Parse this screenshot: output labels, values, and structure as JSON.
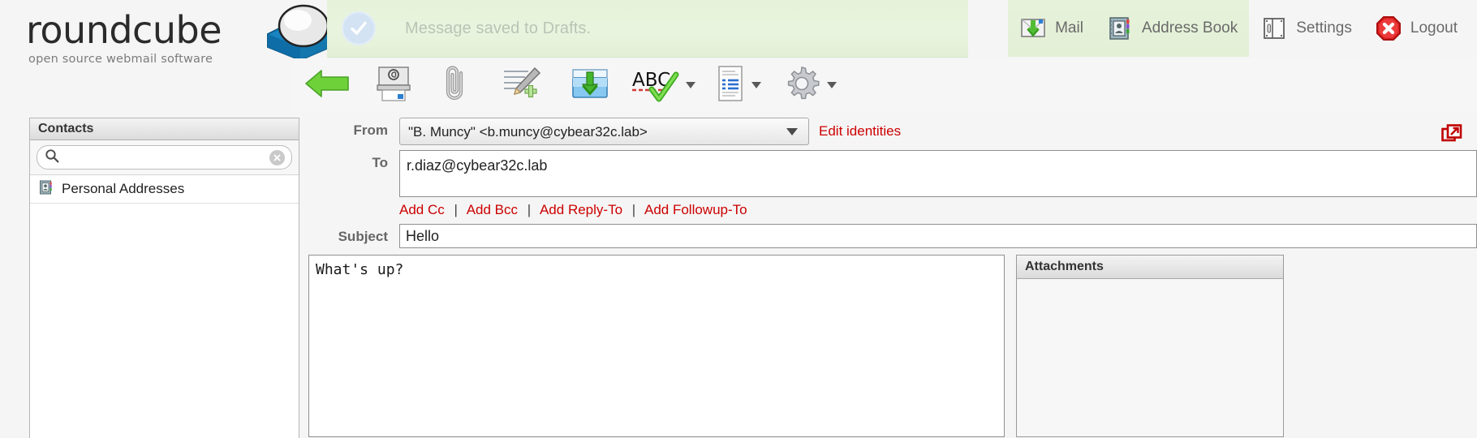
{
  "app": {
    "brand_name": "roundcube",
    "brand_tagline": "open source webmail software",
    "accent_red": "#cc0000",
    "notice_bg": "#e6f2da"
  },
  "notification": {
    "icon": "check-circle-icon",
    "message": "Message saved to Drafts."
  },
  "tasknav": {
    "items": [
      {
        "id": "mail",
        "label": "Mail",
        "icon": "mail-inbox-icon",
        "active": true
      },
      {
        "id": "addressbook",
        "label": "Address Book",
        "icon": "address-book-icon",
        "active": true
      },
      {
        "id": "settings",
        "label": "Settings",
        "icon": "settings-window-icon",
        "active": false
      },
      {
        "id": "logout",
        "label": "Logout",
        "icon": "logout-stop-icon",
        "active": false
      }
    ]
  },
  "toolbar": {
    "buttons": [
      {
        "id": "back",
        "name": "back-button",
        "icon": "green-left-arrow-icon",
        "has_menu": false
      },
      {
        "id": "send",
        "name": "send-button",
        "icon": "send-mail-icon",
        "has_menu": false
      },
      {
        "id": "attach",
        "name": "attach-button",
        "icon": "paperclip-icon",
        "has_menu": false
      },
      {
        "id": "signature",
        "name": "insert-signature-button",
        "icon": "signature-icon",
        "has_menu": false
      },
      {
        "id": "savedraft",
        "name": "save-draft-button",
        "icon": "save-draft-icon",
        "has_menu": false
      },
      {
        "id": "spellcheck",
        "name": "spellcheck-button",
        "icon": "abc-spellcheck-icon",
        "has_menu": true
      },
      {
        "id": "editortype",
        "name": "editor-type-button",
        "icon": "document-editor-icon",
        "has_menu": true
      },
      {
        "id": "options",
        "name": "compose-options-button",
        "icon": "gear-icon",
        "has_menu": true
      }
    ]
  },
  "sidebar": {
    "title": "Contacts",
    "search": {
      "placeholder": "",
      "value": "",
      "icon": "search-icon",
      "clear_icon": "clear-x-icon"
    },
    "sources": [
      {
        "label": "Personal Addresses",
        "icon": "address-book-icon"
      }
    ]
  },
  "compose": {
    "popout_icon": "open-in-new-window-icon",
    "from": {
      "label": "From",
      "selected": "\"B. Muncy\" <b.muncy@cybear32c.lab>",
      "options": [
        "\"B. Muncy\" <b.muncy@cybear32c.lab>"
      ],
      "edit_identities_label": "Edit identities"
    },
    "to": {
      "label": "To",
      "value": "r.diaz@cybear32c.lab",
      "placeholder": ""
    },
    "add_links": [
      {
        "label": "Add Cc"
      },
      {
        "label": "Add Bcc"
      },
      {
        "label": "Add Reply-To"
      },
      {
        "label": "Add Followup-To"
      }
    ],
    "add_links_separator": "|",
    "subject": {
      "label": "Subject",
      "value": "Hello",
      "placeholder": ""
    },
    "body": {
      "value": "What's up?",
      "placeholder": ""
    },
    "attachments": {
      "title": "Attachments",
      "items": []
    }
  }
}
